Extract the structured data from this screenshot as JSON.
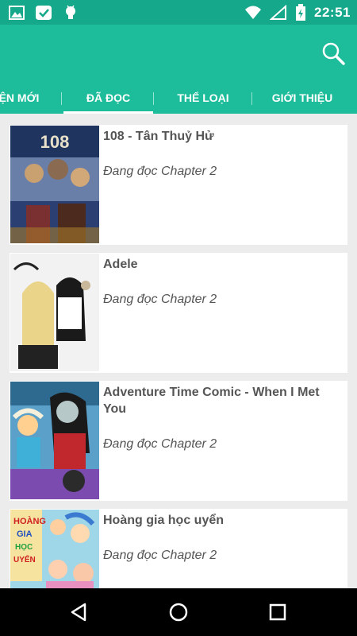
{
  "status_bar": {
    "time": "22:51",
    "left_icons": [
      "image-icon",
      "check-app-icon",
      "android-icon"
    ],
    "right_icons": [
      "wifi-icon",
      "cell-signal-icon",
      "battery-charging-icon"
    ]
  },
  "app_bar": {
    "color": "#1dbc9a",
    "search_icon": "search-icon"
  },
  "tabs": [
    {
      "label": "ỆN MỚI",
      "active": false
    },
    {
      "label": "ĐÃ ĐỌC",
      "active": true
    },
    {
      "label": "THỂ LOẠI",
      "active": false
    },
    {
      "label": "GIỚI THIỆU",
      "active": false
    }
  ],
  "comics": [
    {
      "title": "108 - Tân Thuỷ Hử",
      "status": "Đang đọc Chapter 2"
    },
    {
      "title": "Adele",
      "status": "Đang đọc Chapter 2"
    },
    {
      "title": "Adventure Time Comic - When I Met You",
      "status": "Đang đọc Chapter 2"
    },
    {
      "title": "Hoàng gia học uyển",
      "status": "Đang đọc Chapter 2"
    }
  ],
  "nav_bar": {
    "buttons": [
      "back-icon",
      "home-icon",
      "recents-icon"
    ]
  }
}
